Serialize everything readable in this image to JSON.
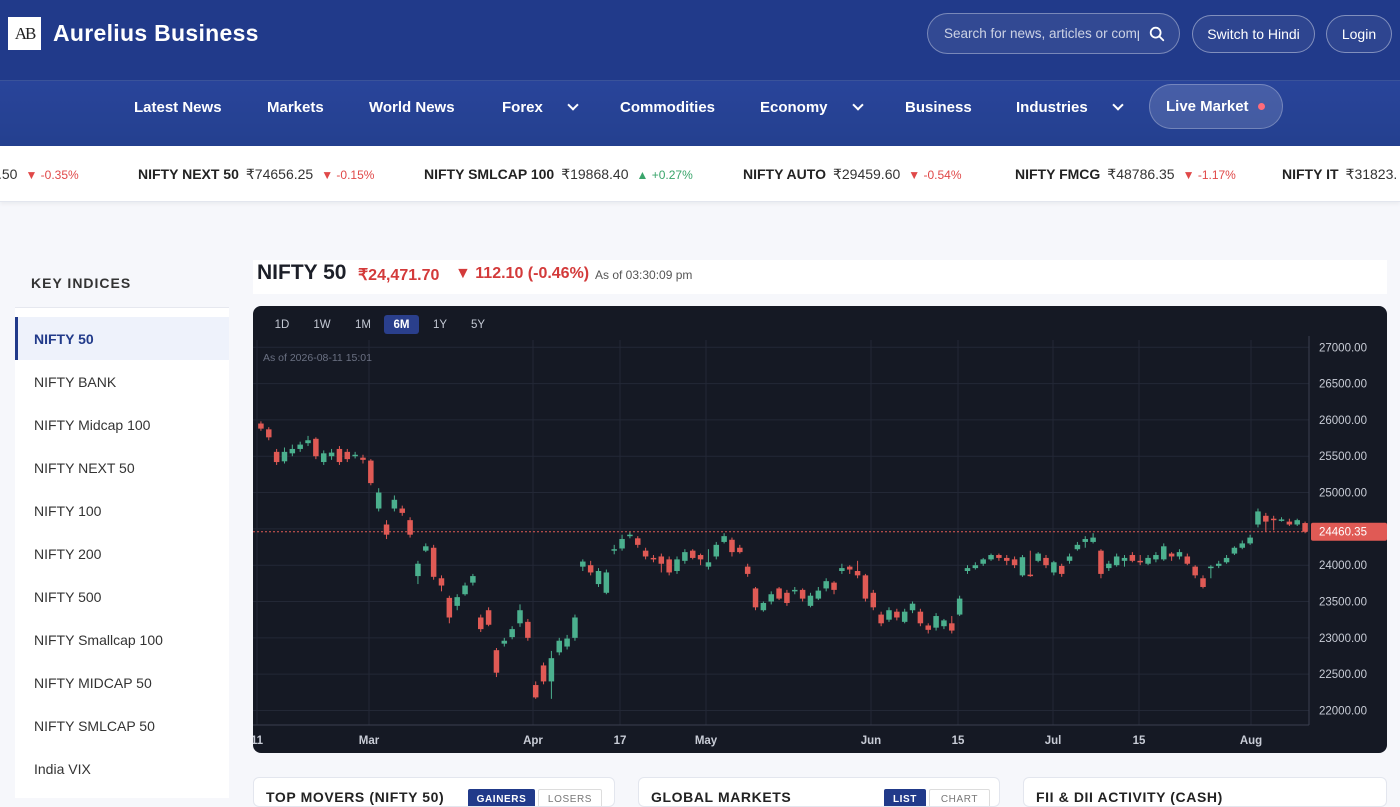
{
  "brand": {
    "logo_text": "AB",
    "name": "Aurelius Business"
  },
  "header": {
    "search_placeholder": "Search for news, articles or companies",
    "switch_lang": "Switch to Hindi",
    "login": "Login"
  },
  "nav": {
    "items": [
      "Latest News",
      "Markets",
      "World News",
      "Forex",
      "Commodities",
      "Economy",
      "Business",
      "Industries"
    ],
    "live": "Live Market"
  },
  "ticker": [
    {
      "name": "",
      "value": ".50",
      "change": "▼ -0.35%",
      "dir": "neg"
    },
    {
      "name": "NIFTY NEXT 50",
      "value": "₹74656.25",
      "change": "▼ -0.15%",
      "dir": "neg"
    },
    {
      "name": "NIFTY SMLCAP 100",
      "value": "₹19868.40",
      "change": "▲ +0.27%",
      "dir": "pos"
    },
    {
      "name": "NIFTY AUTO",
      "value": "₹29459.60",
      "change": "▼ -0.54%",
      "dir": "neg"
    },
    {
      "name": "NIFTY FMCG",
      "value": "₹48786.35",
      "change": "▼ -1.17%",
      "dir": "neg"
    },
    {
      "name": "NIFTY IT",
      "value": "₹31823.",
      "change": "",
      "dir": "neg"
    }
  ],
  "sidebar": {
    "title": "KEY INDICES",
    "items": [
      "NIFTY 50",
      "NIFTY BANK",
      "NIFTY Midcap 100",
      "NIFTY NEXT 50",
      "NIFTY 100",
      "NIFTY 200",
      "NIFTY 500",
      "NIFTY Smallcap 100",
      "NIFTY MIDCAP 50",
      "NIFTY SMLCAP 50",
      "India VIX"
    ],
    "active": 0
  },
  "quote": {
    "name": "NIFTY 50",
    "price": "₹24,471.70",
    "change": "▼ 112.10 (-0.46%)",
    "as_of": "As of 03:30:09 pm"
  },
  "ranges": [
    "1D",
    "1W",
    "1M",
    "6M",
    "1Y",
    "5Y"
  ],
  "selected_range": "6M",
  "chart_data": {
    "type": "candlestick",
    "watermark": "As of 2026-08-11 15:01",
    "ylim": [
      21800,
      27100
    ],
    "yticks": [
      "27000.00",
      "26500.00",
      "26000.00",
      "25500.00",
      "25000.00",
      "24500.00",
      "24000.00",
      "23500.00",
      "23000.00",
      "22500.00",
      "22000.00"
    ],
    "xticks": [
      "11",
      "Mar",
      "Apr",
      "17",
      "May",
      "Jun",
      "15",
      "Jul",
      "15",
      "Aug"
    ],
    "last_price_label": "24460.35",
    "colors": {
      "up": "#4bb08e",
      "down": "#e05a55",
      "bg": "#151924",
      "grid": "#232836"
    },
    "candles": [
      [
        25950,
        25880,
        25980,
        25850
      ],
      [
        25870,
        25760,
        25900,
        25720
      ],
      [
        25560,
        25420,
        25600,
        25380
      ],
      [
        25430,
        25560,
        25620,
        25400
      ],
      [
        25540,
        25600,
        25660,
        25500
      ],
      [
        25600,
        25660,
        25700,
        25560
      ],
      [
        25680,
        25720,
        25780,
        25640
      ],
      [
        25740,
        25500,
        25760,
        25460
      ],
      [
        25420,
        25540,
        25580,
        25380
      ],
      [
        25500,
        25550,
        25600,
        25450
      ],
      [
        25600,
        25420,
        25640,
        25380
      ],
      [
        25560,
        25460,
        25600,
        25420
      ],
      [
        25500,
        25520,
        25560,
        25470
      ],
      [
        25480,
        25450,
        25520,
        25400
      ],
      [
        25440,
        25130,
        25460,
        25100
      ],
      [
        24780,
        25000,
        25060,
        24740
      ],
      [
        24560,
        24420,
        24620,
        24360
      ],
      [
        24780,
        24900,
        24960,
        24740
      ],
      [
        24780,
        24720,
        24820,
        24680
      ],
      [
        24620,
        24420,
        24660,
        24380
      ],
      [
        23850,
        24020,
        24060,
        23740
      ],
      [
        24200,
        24260,
        24300,
        24180
      ],
      [
        24240,
        23840,
        24280,
        23800
      ],
      [
        23820,
        23720,
        23860,
        23640
      ],
      [
        23550,
        23280,
        23580,
        23200
      ],
      [
        23440,
        23560,
        23600,
        23380
      ],
      [
        23600,
        23720,
        23760,
        23580
      ],
      [
        23760,
        23850,
        23880,
        23720
      ],
      [
        23280,
        23120,
        23320,
        23080
      ],
      [
        23380,
        23180,
        23420,
        23160
      ],
      [
        22830,
        22520,
        22860,
        22460
      ],
      [
        22920,
        22960,
        23000,
        22880
      ],
      [
        23010,
        23120,
        23160,
        22980
      ],
      [
        23200,
        23380,
        23460,
        23150
      ],
      [
        23220,
        23000,
        23260,
        22960
      ],
      [
        22350,
        22180,
        22400,
        22160
      ],
      [
        22620,
        22400,
        22660,
        22360
      ],
      [
        22400,
        22720,
        22820,
        22160
      ],
      [
        22800,
        22960,
        23000,
        22760
      ],
      [
        22880,
        22990,
        23040,
        22840
      ],
      [
        23000,
        23280,
        23320,
        22960
      ],
      [
        23980,
        24050,
        24080,
        23920
      ],
      [
        24000,
        23900,
        24060,
        23860
      ],
      [
        23740,
        23920,
        23960,
        23700
      ],
      [
        23620,
        23900,
        23940,
        23600
      ],
      [
        24200,
        24220,
        24280,
        24150
      ],
      [
        24230,
        24360,
        24420,
        24200
      ],
      [
        24400,
        24420,
        24460,
        24370
      ],
      [
        24370,
        24280,
        24400,
        24240
      ],
      [
        24200,
        24120,
        24240,
        24080
      ],
      [
        24100,
        24090,
        24140,
        24040
      ],
      [
        24120,
        24020,
        24160,
        23900
      ],
      [
        24080,
        23900,
        24120,
        23860
      ],
      [
        23920,
        24080,
        24120,
        23880
      ],
      [
        24060,
        24180,
        24220,
        24020
      ],
      [
        24200,
        24100,
        24220,
        24080
      ],
      [
        24140,
        24080,
        24160,
        24000
      ],
      [
        23980,
        24040,
        24220,
        23940
      ],
      [
        24120,
        24280,
        24320,
        24080
      ],
      [
        24320,
        24400,
        24440,
        24300
      ],
      [
        24350,
        24180,
        24380,
        24120
      ],
      [
        24240,
        24180,
        24280,
        24160
      ],
      [
        23980,
        23880,
        24020,
        23840
      ],
      [
        23680,
        23420,
        23700,
        23380
      ],
      [
        23380,
        23480,
        23500,
        23360
      ],
      [
        23500,
        23600,
        23640,
        23460
      ],
      [
        23680,
        23540,
        23700,
        23520
      ],
      [
        23620,
        23480,
        23660,
        23440
      ],
      [
        23640,
        23660,
        23700,
        23600
      ],
      [
        23660,
        23540,
        23680,
        23500
      ],
      [
        23440,
        23580,
        23620,
        23420
      ],
      [
        23540,
        23650,
        23700,
        23520
      ],
      [
        23680,
        23780,
        23820,
        23640
      ],
      [
        23760,
        23660,
        23780,
        23600
      ],
      [
        23920,
        23960,
        24020,
        23880
      ],
      [
        23980,
        23940,
        24000,
        23880
      ],
      [
        23920,
        23860,
        24060,
        23820
      ],
      [
        23860,
        23540,
        23880,
        23500
      ],
      [
        23620,
        23420,
        23660,
        23380
      ],
      [
        23320,
        23200,
        23360,
        23160
      ],
      [
        23250,
        23380,
        23420,
        23220
      ],
      [
        23360,
        23280,
        23400,
        23240
      ],
      [
        23220,
        23360,
        23400,
        23200
      ],
      [
        23380,
        23470,
        23500,
        23340
      ],
      [
        23360,
        23200,
        23400,
        23160
      ],
      [
        23170,
        23110,
        23200,
        23060
      ],
      [
        23140,
        23300,
        23340,
        23100
      ],
      [
        23160,
        23240,
        23260,
        23120
      ],
      [
        23200,
        23100,
        23300,
        23060
      ],
      [
        23320,
        23540,
        23580,
        23300
      ],
      [
        23920,
        23960,
        24000,
        23880
      ],
      [
        23960,
        24000,
        24040,
        23940
      ],
      [
        24020,
        24080,
        24100,
        23990
      ],
      [
        24080,
        24140,
        24160,
        24060
      ],
      [
        24140,
        24100,
        24160,
        24060
      ],
      [
        24100,
        24060,
        24140,
        24000
      ],
      [
        24080,
        24000,
        24120,
        23960
      ],
      [
        23860,
        24110,
        24140,
        23840
      ],
      [
        23870,
        23860,
        24200,
        23840
      ],
      [
        24060,
        24160,
        24180,
        24040
      ],
      [
        24100,
        24000,
        24140,
        23960
      ],
      [
        23900,
        24040,
        24060,
        23860
      ],
      [
        23990,
        23880,
        24020,
        23840
      ],
      [
        24060,
        24120,
        24160,
        24020
      ],
      [
        24220,
        24280,
        24320,
        24200
      ],
      [
        24320,
        24360,
        24400,
        24240
      ],
      [
        24320,
        24380,
        24440,
        24300
      ],
      [
        24200,
        23880,
        24220,
        23820
      ],
      [
        23960,
        24020,
        24060,
        23920
      ],
      [
        24000,
        24120,
        24160,
        23980
      ],
      [
        24060,
        24100,
        24140,
        23980
      ],
      [
        24140,
        24060,
        24180,
        24040
      ],
      [
        24060,
        24040,
        24140,
        24000
      ],
      [
        24020,
        24100,
        24140,
        24000
      ],
      [
        24080,
        24140,
        24180,
        24040
      ],
      [
        24080,
        24260,
        24300,
        24060
      ],
      [
        24160,
        24120,
        24180,
        24060
      ],
      [
        24120,
        24180,
        24220,
        24080
      ],
      [
        24120,
        24020,
        24160,
        24000
      ],
      [
        23980,
        23860,
        24000,
        23820
      ],
      [
        23820,
        23700,
        23860,
        23680
      ],
      [
        23960,
        23980,
        24000,
        23820
      ],
      [
        23990,
        24020,
        24060,
        23960
      ],
      [
        24040,
        24100,
        24140,
        24020
      ],
      [
        24160,
        24240,
        24260,
        24140
      ],
      [
        24240,
        24300,
        24340,
        24220
      ],
      [
        24300,
        24380,
        24420,
        24280
      ],
      [
        24560,
        24740,
        24780,
        24520
      ],
      [
        24680,
        24600,
        24720,
        24460
      ],
      [
        24640,
        24620,
        24680,
        24480
      ],
      [
        24620,
        24630,
        24660,
        24600
      ],
      [
        24600,
        24560,
        24640,
        24540
      ],
      [
        24560,
        24620,
        24640,
        24540
      ],
      [
        24580,
        24460,
        24600,
        24440
      ]
    ]
  },
  "bottom_cards": [
    {
      "title": "TOP MOVERS (NIFTY 50)",
      "tabs": [
        "GAINERS",
        "LOSERS"
      ]
    },
    {
      "title": "GLOBAL MARKETS",
      "tabs": [
        "LIST",
        "CHART"
      ]
    },
    {
      "title": "FII & DII ACTIVITY (CASH)",
      "tabs": []
    }
  ]
}
